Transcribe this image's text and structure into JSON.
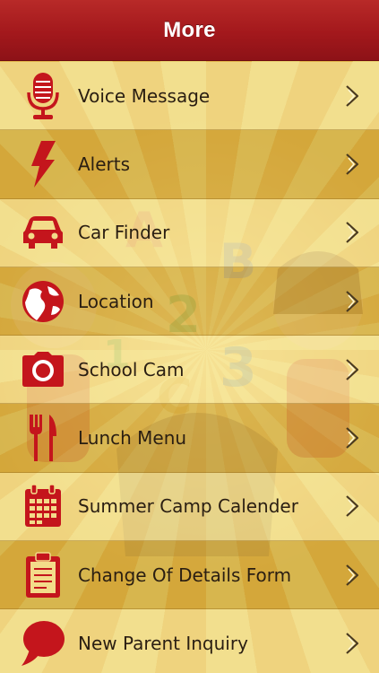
{
  "header": {
    "title": "More"
  },
  "colors": {
    "accent": "#c4151c",
    "header": "#a3181c",
    "text": "#2a1e12"
  },
  "menu": [
    {
      "label": "Voice Message",
      "icon": "microphone-icon"
    },
    {
      "label": "Alerts",
      "icon": "lightning-icon"
    },
    {
      "label": "Car Finder",
      "icon": "car-icon"
    },
    {
      "label": "Location",
      "icon": "globe-icon"
    },
    {
      "label": "School Cam",
      "icon": "camera-icon"
    },
    {
      "label": "Lunch Menu",
      "icon": "fork-knife-icon"
    },
    {
      "label": "Summer Camp Calender",
      "icon": "calendar-icon"
    },
    {
      "label": "Change Of Details Form",
      "icon": "clipboard-icon"
    },
    {
      "label": "New Parent Inquiry",
      "icon": "speech-bubble-icon"
    }
  ]
}
